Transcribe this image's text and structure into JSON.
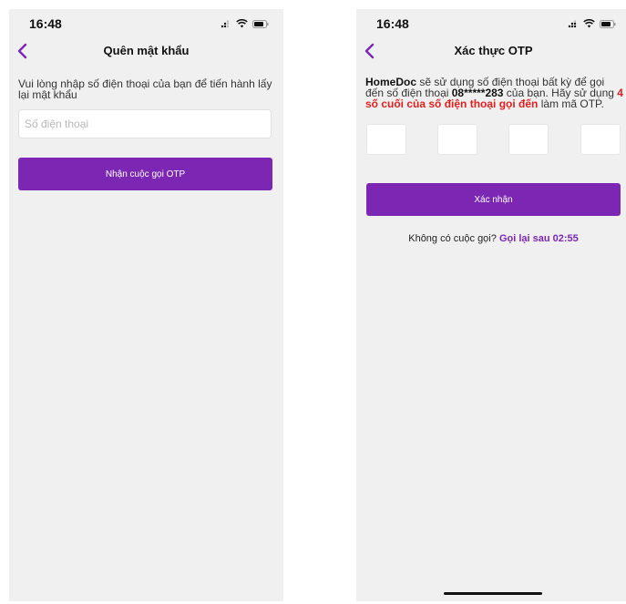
{
  "left_screen": {
    "status": {
      "time": "16:48"
    },
    "nav": {
      "title": "Quên mật khẩu"
    },
    "description": "Vui lòng nhập số điện thoại của bạn để tiến hành lấy lại mật khẩu",
    "phone_input": {
      "placeholder": "Số điện thoại",
      "value": ""
    },
    "submit_label": "Nhận cuộc gọi OTP"
  },
  "right_screen": {
    "status": {
      "time": "16:48"
    },
    "nav": {
      "title": "Xác thực OTP"
    },
    "description": {
      "brand": "HomeDoc",
      "part1": " sẽ sử dụng số điện thoại bất kỳ để gọi đến số điện thoại ",
      "masked_phone": "08*****283",
      "part2": " của bạn. Hãy sử dụng ",
      "highlight": "4 số cuối của số điện thoại gọi đến",
      "part3": " làm mã OTP."
    },
    "otp_digits": [
      "",
      "",
      "",
      ""
    ],
    "confirm_label": "Xác nhận",
    "retry_prompt": "Không có cuộc gọi?",
    "retry_link": "Gọi lại sau 02:55"
  },
  "colors": {
    "accent": "#7c27b4",
    "highlight_red": "#e02020",
    "screen_bg": "#f0f0f0"
  }
}
